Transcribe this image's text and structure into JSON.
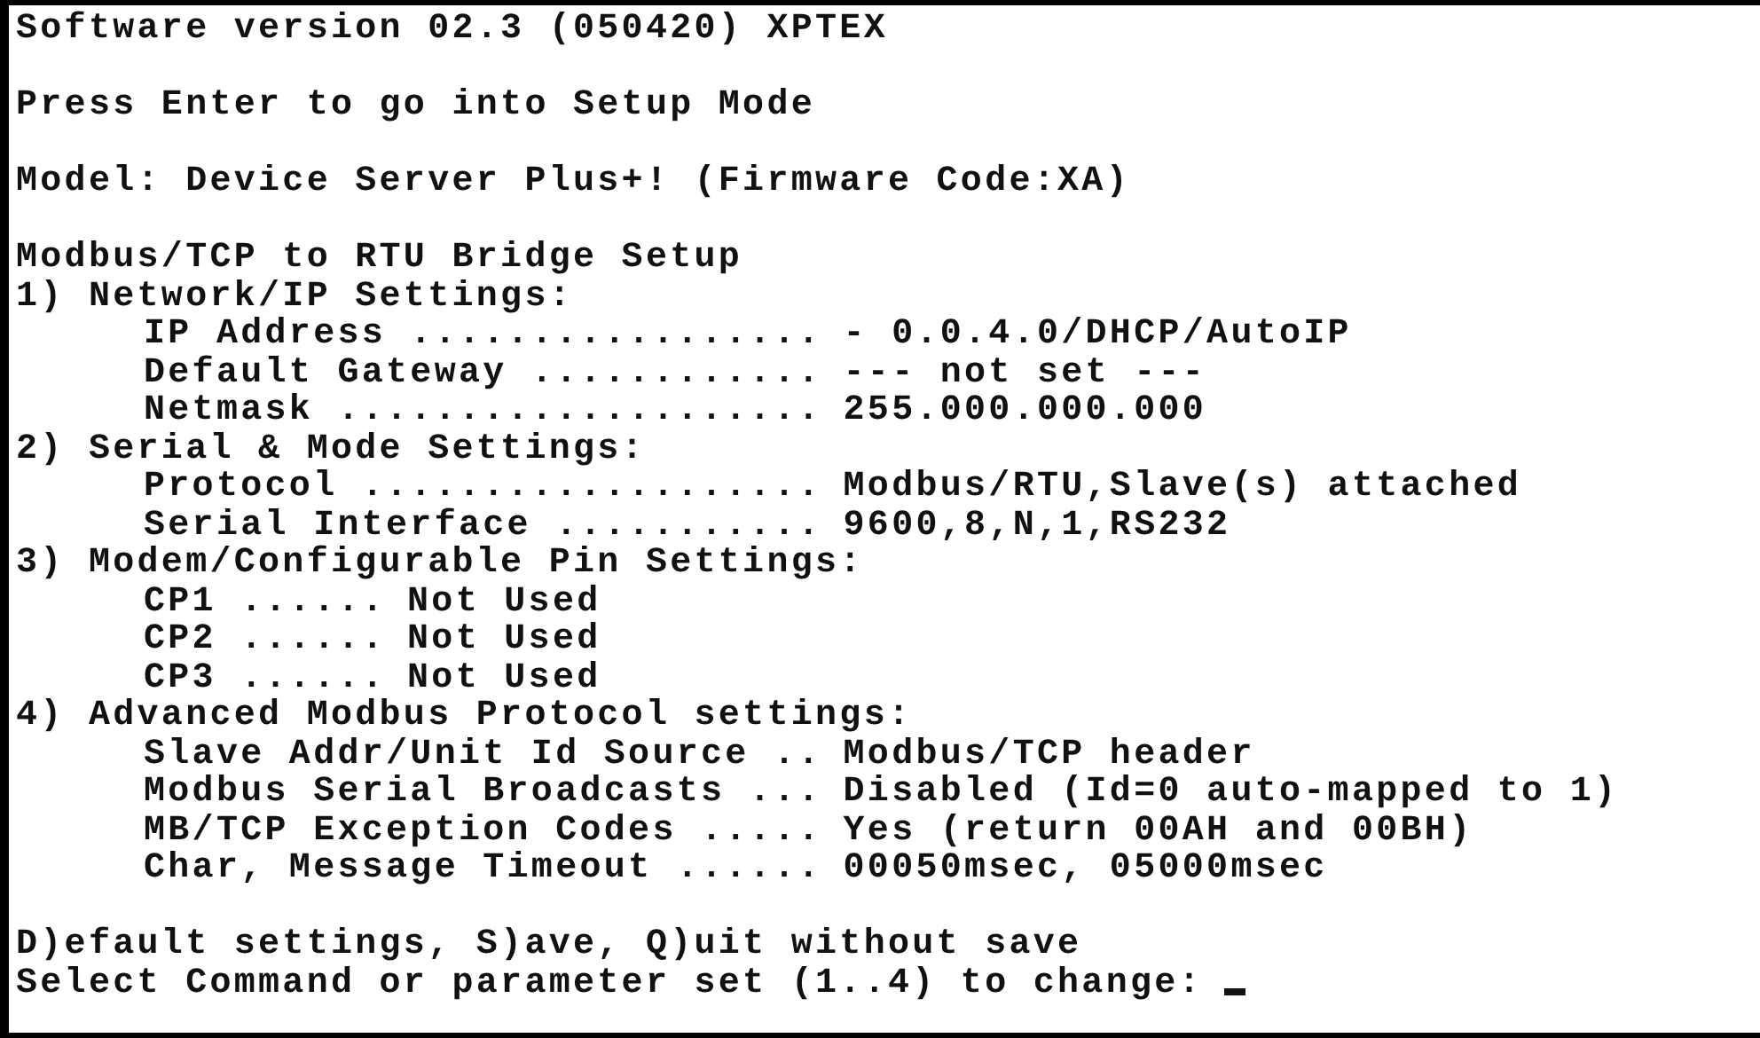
{
  "intro": [
    "Software version 02.3 (050420) XPTEX",
    "Press Enter to go into Setup Mode",
    "Model: Device Server Plus+! (Firmware Code:XA)"
  ],
  "setup": {
    "title": "Modbus/TCP to RTU Bridge Setup",
    "sections": [
      {
        "title": "1) Network/IP Settings:",
        "kind": "aligned",
        "children": [
          {
            "label": "IP Address .................",
            "value": "- 0.0.4.0/DHCP/AutoIP"
          },
          {
            "label": "Default Gateway ............",
            "value": "--- not set ---"
          },
          {
            "label": "Netmask ....................",
            "value": "255.000.000.000"
          }
        ]
      },
      {
        "title": "2) Serial & Mode Settings:",
        "kind": "aligned",
        "children": [
          {
            "label": "Protocol ...................",
            "value": "Modbus/RTU,Slave(s) attached"
          },
          {
            "label": "Serial Interface ...........",
            "value": "9600,8,N,1,RS232"
          }
        ]
      },
      {
        "title": "3) Modem/Configurable Pin Settings:",
        "kind": "inline",
        "children": [
          {
            "label": "CP1 ......",
            "value": "Not Used"
          },
          {
            "label": "CP2 ......",
            "value": "Not Used"
          },
          {
            "label": "CP3 ......",
            "value": "Not Used"
          }
        ]
      },
      {
        "title": "4) Advanced Modbus Protocol settings:",
        "kind": "aligned",
        "children": [
          {
            "label": "Slave Addr/Unit Id Source ..",
            "value": "Modbus/TCP header"
          },
          {
            "label": "Modbus Serial Broadcasts ...",
            "value": "Disabled (Id=0 auto-mapped to 1)"
          },
          {
            "label": "MB/TCP Exception Codes .....",
            "value": "Yes (return 00AH and 00BH)"
          },
          {
            "label": "Char, Message Timeout ......",
            "value": "00050msec, 05000msec"
          }
        ]
      }
    ]
  },
  "menu": "D)efault settings, S)ave, Q)uit without save",
  "prompt": "Select Command or parameter set (1..4) to change:"
}
